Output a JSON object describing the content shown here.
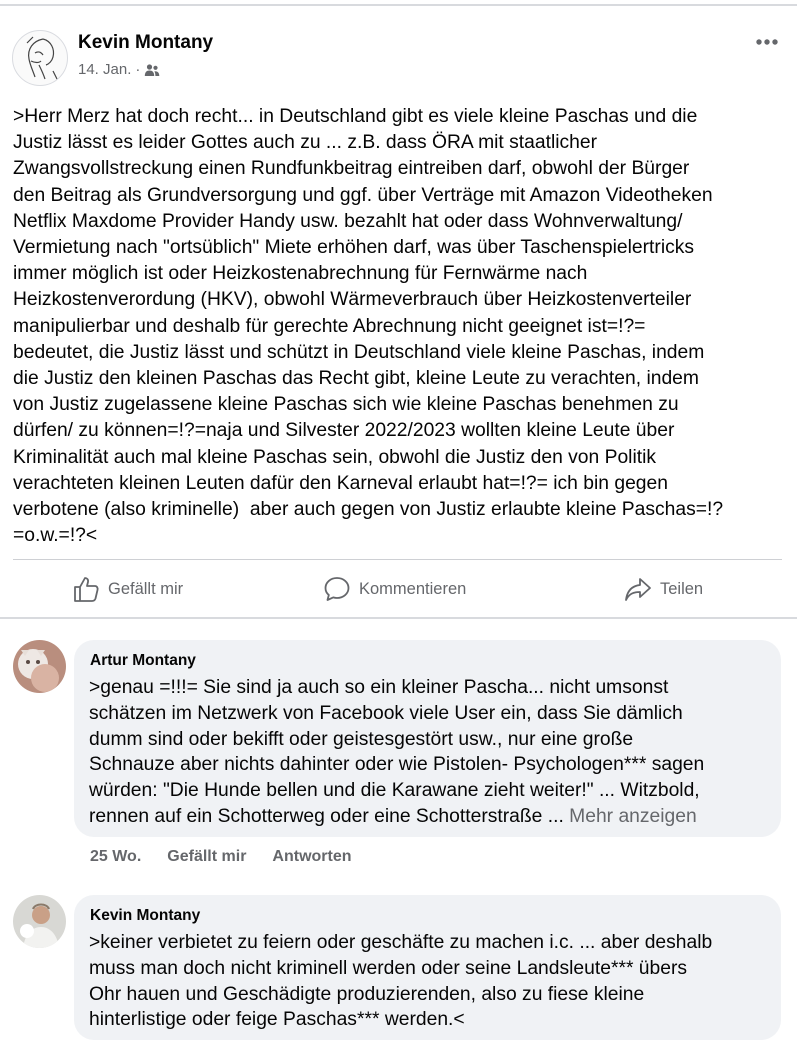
{
  "post": {
    "author": "Kevin Montany",
    "date": "14. Jan.",
    "separator": "·",
    "audience_icon": "friends-icon",
    "more_icon": "more-dots-icon",
    "text": ">Herr Merz hat doch recht... in Deutschland gibt es viele kleine Paschas und die\nJustiz lässt es leider Gottes auch zu ... z.B. dass ÖRA mit staatlicher\nZwangsvollstreckung einen Rundfunkbeitrag eintreiben darf, obwohl der Bürger\nden Beitrag als Grundversorgung und ggf. über Verträge mit Amazon Videotheken\nNetflix Maxdome Provider Handy usw. bezahlt hat oder dass Wohnverwaltung/\nVermietung nach \"ortsüblich\" Miete erhöhen darf, was über Taschenspielertricks\nimmer möglich ist oder Heizkostenabrechnung für Fernwärme nach\nHeizkostenverordung (HKV), obwohl Wärmeverbrauch über Heizkostenverteiler\nmanipulierbar und deshalb für gerechte Abrechnung nicht geeignet ist=!?=\nbedeutet, die Justiz lässt und schützt in Deutschland viele kleine Paschas, indem\ndie Justiz den kleinen Paschas das Recht gibt, kleine Leute zu verachten, indem\nvon Justiz zugelassene kleine Paschas sich wie kleine Paschas benehmen zu\ndürfen/ zu können=!?=naja und Silvester 2022/2023 wollten kleine Leute über\nKriminalität auch mal kleine Paschas sein, obwohl die Justiz den von Politik\nverachteten kleinen Leuten dafür den Karneval erlaubt hat=!?= ich bin gegen\nverbotene (also kriminelle)  aber auch gegen von Justiz erlaubte kleine Paschas=!?\n=o.w.=!?<"
  },
  "actions": {
    "like": "Gefällt mir",
    "comment": "Kommentieren",
    "share": "Teilen"
  },
  "comments": [
    {
      "author": "Artur Montany",
      "text": ">genau =!!!= Sie sind ja auch so ein kleiner Pascha... nicht umsonst\nschätzen im Netzwerk von Facebook viele User ein, dass Sie dämlich\ndumm sind oder bekifft oder geistesgestört usw., nur eine große\nSchnauze aber nichts dahinter oder wie Pistolen- Psychologen*** sagen\nwürden: \"Die Hunde bellen und die Karawane zieht weiter!\" ... Witzbold,\nrennen auf ein Schotterweg oder eine Schotterstraße ... ",
      "more": "Mehr anzeigen",
      "time": "25 Wo.",
      "like": "Gefällt mir",
      "reply": "Antworten"
    },
    {
      "author": "Kevin Montany",
      "text": ">keiner verbietet zu feiern oder geschäfte zu machen i.c. ... aber deshalb\nmuss man doch nicht kriminell werden oder seine Landsleute*** übers\nOhr hauen und Geschädigte produzierenden, also zu fiese kleine\nhinterlistige oder feige Paschas*** werden.<"
    }
  ],
  "colors": {
    "text": "#050505",
    "secondary": "#65676b",
    "bubble": "#f0f2f5",
    "divider": "#ced0d4"
  }
}
